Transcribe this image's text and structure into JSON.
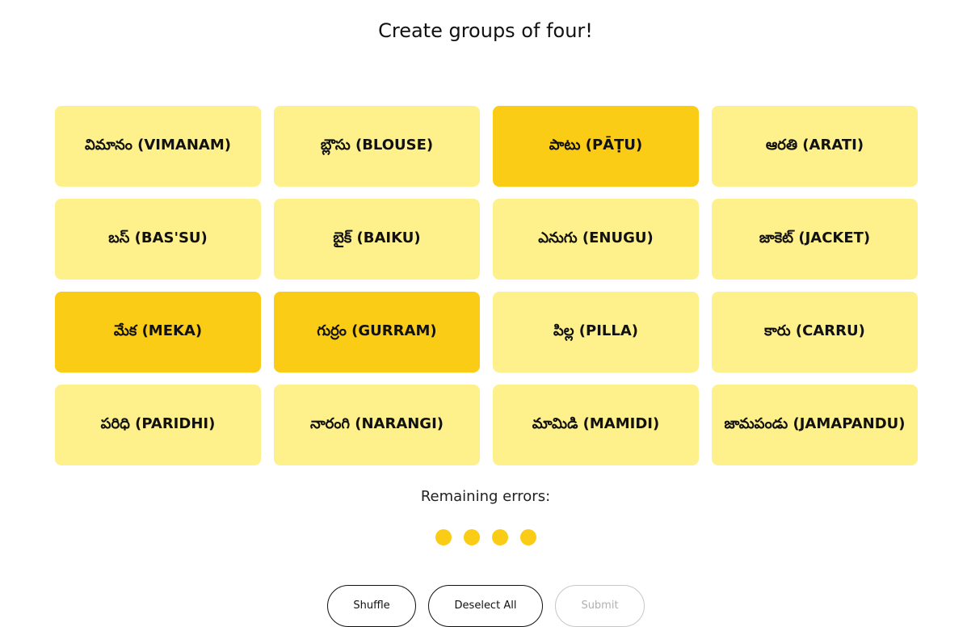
{
  "title": "Create groups of four!",
  "tiles": [
    {
      "label": "విమానం (VIMANAM)",
      "selected": false
    },
    {
      "label": "బ్లౌసు (BLOUSE)",
      "selected": false
    },
    {
      "label": "పాటు (PĀṬU)",
      "selected": true
    },
    {
      "label": "ఆరతి (ARATI)",
      "selected": false
    },
    {
      "label": "బస్ (BAS'SU)",
      "selected": false
    },
    {
      "label": "బైక్ (BAIKU)",
      "selected": false
    },
    {
      "label": "ఎనుగు (ENUGU)",
      "selected": false
    },
    {
      "label": "జాకెట్ (JACKET)",
      "selected": false
    },
    {
      "label": "మేక (MEKA)",
      "selected": true
    },
    {
      "label": "గుర్రం (GURRAM)",
      "selected": true
    },
    {
      "label": "పిల్ల (PILLA)",
      "selected": false
    },
    {
      "label": "కారు (CARRU)",
      "selected": false
    },
    {
      "label": "పరిధి (PARIDHI)",
      "selected": false
    },
    {
      "label": "నారంగి (NARANGI)",
      "selected": false
    },
    {
      "label": "మామిడి (MAMIDI)",
      "selected": false
    },
    {
      "label": "జామపండు (JAMAPANDU)",
      "selected": false
    }
  ],
  "remaining_errors": {
    "label": "Remaining errors:",
    "count": 4
  },
  "buttons": {
    "shuffle": "Shuffle",
    "deselect_all": "Deselect All",
    "submit": "Submit"
  },
  "colors": {
    "tile": "#fef08a",
    "tile_selected": "#facc15",
    "error_dot": "#facc15"
  }
}
